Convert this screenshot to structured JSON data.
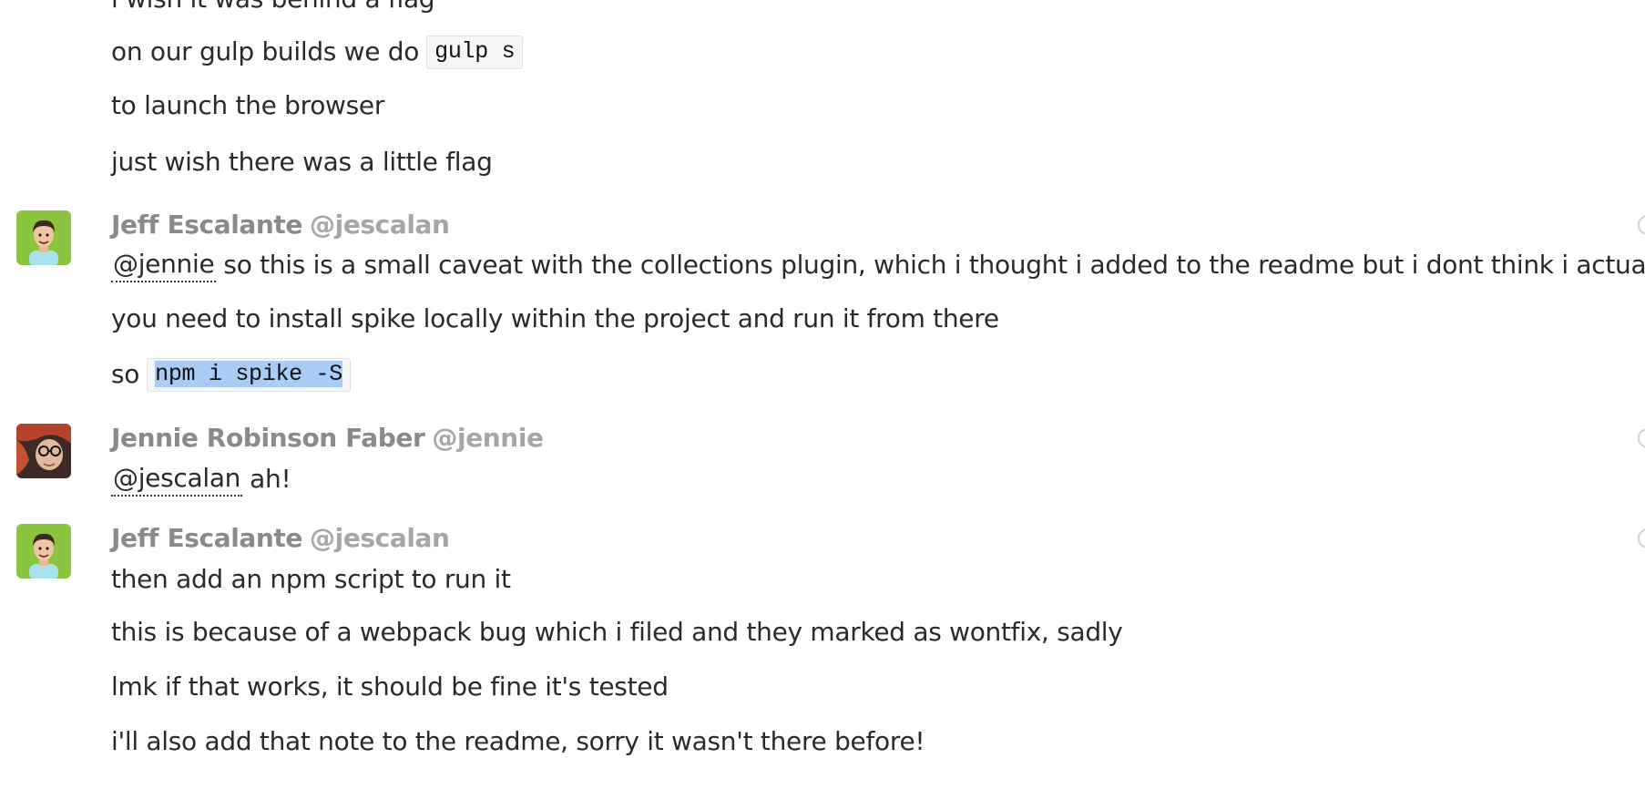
{
  "messages": {
    "partial_top": "i wish it was behind a flag",
    "g0_line1_text": "on our gulp builds we do",
    "g0_line1_code": "gulp s",
    "g0_line2": "to launch the browser",
    "g0_line3": "just wish there was a little flag",
    "g1": {
      "author": "Jeff Escalante",
      "handle": "@jescalan",
      "avatar_icon": "avatar-jeff-icon",
      "line1_mention": "@jennie",
      "line1_text": "so this is a small caveat with the collections plugin, which i thought i added to the readme but i dont think i actually did",
      "line2": "you need to install spike locally within the project and run it from there",
      "line3_text": "so",
      "line3_code": "npm i spike -S"
    },
    "g2": {
      "author": "Jennie Robinson Faber",
      "handle": "@jennie",
      "avatar_icon": "avatar-jennie-icon",
      "line1_mention": "@jescalan",
      "line1_text": "ah!"
    },
    "g3": {
      "author": "Jeff Escalante",
      "handle": "@jescalan",
      "avatar_icon": "avatar-jeff-icon",
      "line1": "then add an npm script to run it",
      "line2": "this is because of a webpack bug which i filed and they marked as wontfix, sadly",
      "line3": "lmk if that works, it should be fine it's tested",
      "line4": "i'll also add that note to the readme, sorry it wasn't there before!"
    }
  },
  "colors": {
    "author_name": "#8a8a8a",
    "handle": "#a6a6a6",
    "selection": "#a9ccf6",
    "avatar_green": "#8bc53f"
  }
}
